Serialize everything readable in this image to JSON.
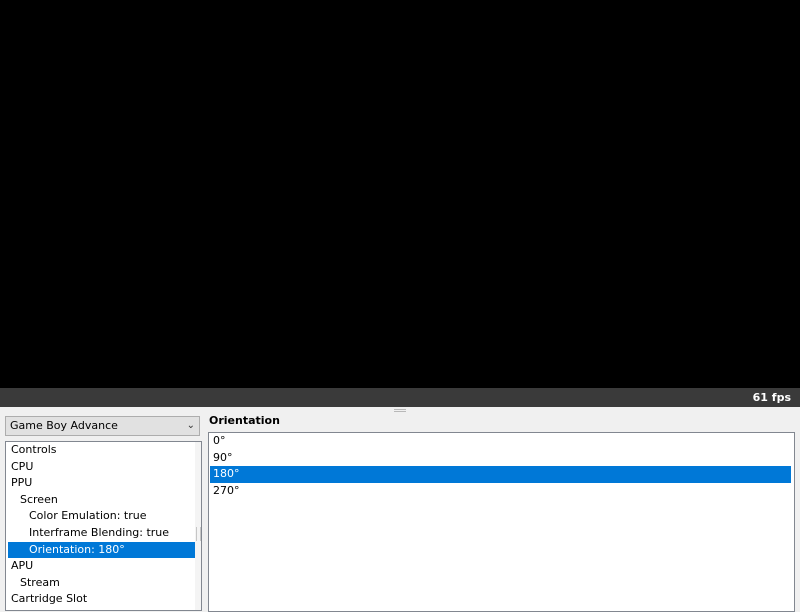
{
  "status": {
    "fps": "61 fps"
  },
  "system_select": {
    "value": "Game Boy Advance",
    "icon": "chevron-down-icon"
  },
  "tree": {
    "items": [
      {
        "label": "Controls",
        "level": 0,
        "selected": false
      },
      {
        "label": "CPU",
        "level": 0,
        "selected": false
      },
      {
        "label": "PPU",
        "level": 0,
        "selected": false
      },
      {
        "label": "Screen",
        "level": 1,
        "selected": false
      },
      {
        "label": "Color Emulation: true",
        "level": 2,
        "selected": false
      },
      {
        "label": "Interframe Blending: true",
        "level": 2,
        "selected": false
      },
      {
        "label": "Orientation: 180°",
        "level": 2,
        "selected": true
      },
      {
        "label": "APU",
        "level": 0,
        "selected": false
      },
      {
        "label": "Stream",
        "level": 1,
        "selected": false
      },
      {
        "label": "Cartridge Slot",
        "level": 0,
        "selected": false
      }
    ]
  },
  "setting": {
    "heading": "Orientation",
    "options": [
      {
        "label": "0°",
        "selected": false
      },
      {
        "label": "90°",
        "selected": false
      },
      {
        "label": "180°",
        "selected": true
      },
      {
        "label": "270°",
        "selected": false
      }
    ]
  },
  "colors": {
    "selection": "#0078d7",
    "statusbar": "#3a3a3a",
    "video": "#000000"
  }
}
